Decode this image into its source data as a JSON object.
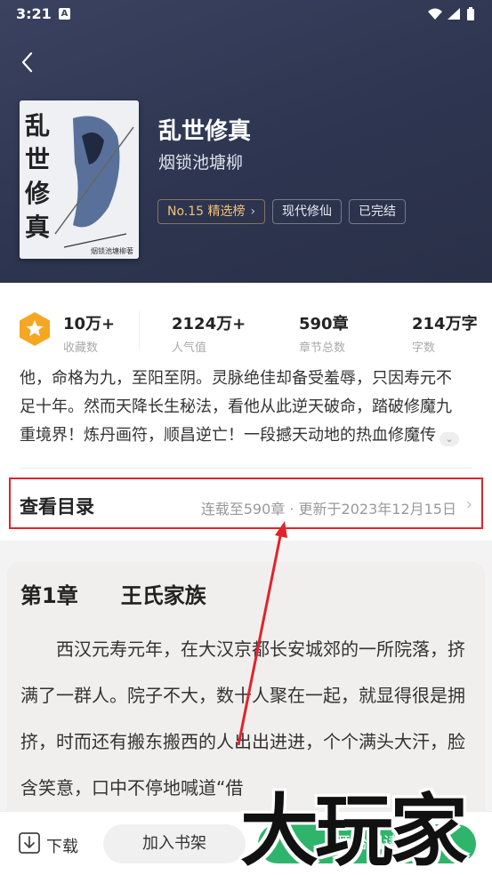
{
  "status_bar": {
    "time": "3:21",
    "notification_icon": "A"
  },
  "book": {
    "title": "乱世修真",
    "author": "烟锁池塘柳",
    "cover_title": "乱世修真",
    "cover_author": "烟锁池塘柳著",
    "tags": [
      {
        "label": "No.15 精选榜"
      },
      {
        "label": "现代修仙"
      },
      {
        "label": "已完结"
      }
    ]
  },
  "stats": [
    {
      "value": "10万+",
      "label": "收藏数"
    },
    {
      "value": "2124万+",
      "label": "人气值"
    },
    {
      "value": "590章",
      "label": "章节总数"
    },
    {
      "value": "214万字",
      "label": "字数"
    }
  ],
  "description": "他，命格为九，至阳至阴。灵脉绝佳却备受羞辱，只因寿元不足十年。然而天降长生秘法，看他从此逆天破命，踏破修魔九重境界！炼丹画符，顺昌逆亡！一段撼天动地的热血修魔传",
  "catalog": {
    "label": "查看目录",
    "meta": "连载至590章 · 更新于2023年12月15日"
  },
  "chapter": {
    "title": "第1章　　王氏家族",
    "body": "西汉元寿元年，在大汉京都长安城郊的一所院落，挤满了一群人。院子不大，数十人聚在一起，就显得很是拥挤，时而还有搬东搬西的人出出进进，个个满头大汗，脸含笑意，口中不停地喊道“借"
  },
  "bottom_bar": {
    "download_label": "下载",
    "shelf_label": "加入书架",
    "start_label": "开始阅读"
  },
  "watermark": "大玩家",
  "colors": {
    "header_bg": "#2d3550",
    "rank_tag": "#f1c27b",
    "highlight_box": "#e0242b",
    "start_button": "#2fb46b",
    "badge": "#f5a623"
  }
}
